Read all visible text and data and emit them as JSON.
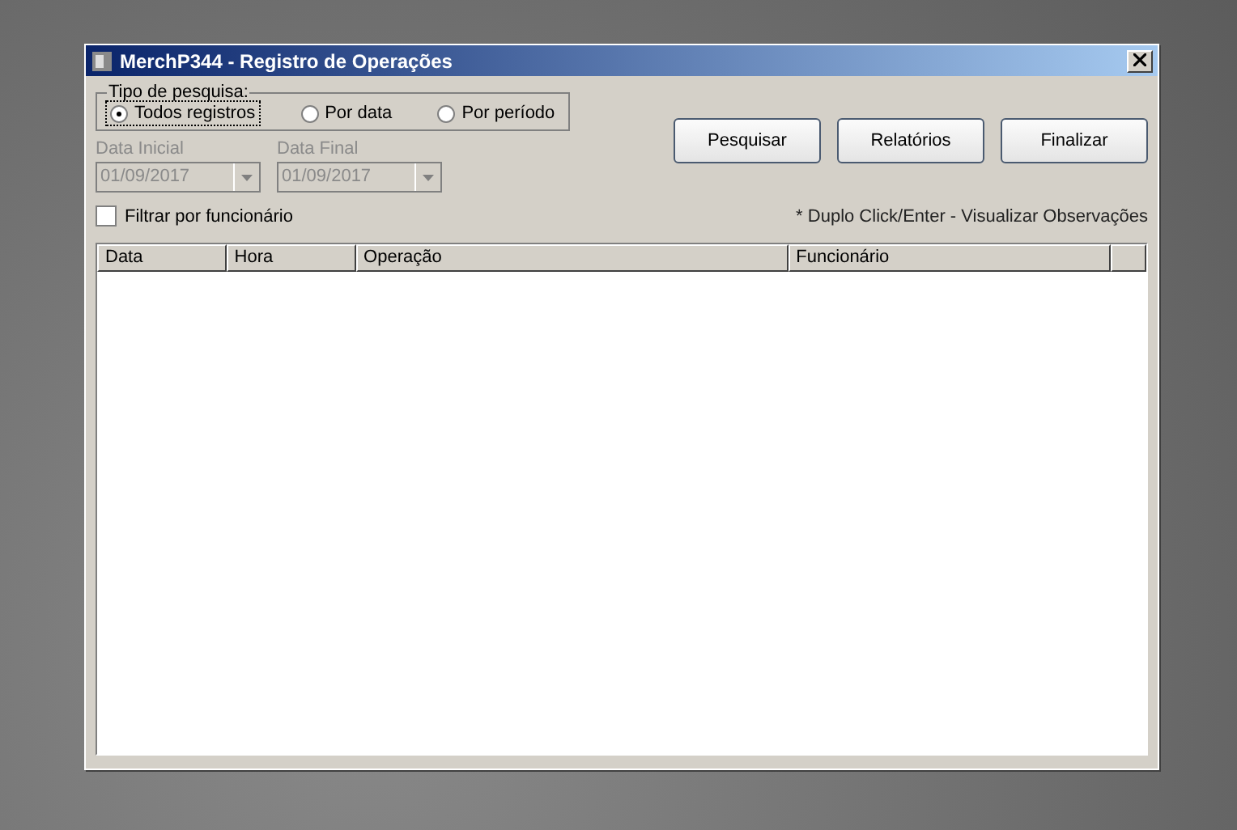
{
  "window": {
    "title": "MerchP344 - Registro de Operações"
  },
  "search_type": {
    "legend": "Tipo de pesquisa:",
    "options": [
      {
        "label": "Todos registros",
        "selected": true
      },
      {
        "label": "Por data",
        "selected": false
      },
      {
        "label": "Por período",
        "selected": false
      }
    ]
  },
  "dates": [
    {
      "label": "Data Inicial",
      "value": "01/09/2017",
      "disabled": true
    },
    {
      "label": "Data Final",
      "value": "01/09/2017",
      "disabled": true
    }
  ],
  "buttons": [
    "Pesquisar",
    "Relatórios",
    "Finalizar"
  ],
  "filter": {
    "label": "Filtrar por funcionário",
    "checked": false
  },
  "hint": "* Duplo Click/Enter - Visualizar Observações",
  "table": {
    "columns": [
      "Data",
      "Hora",
      "Operação",
      "Funcionário"
    ]
  }
}
